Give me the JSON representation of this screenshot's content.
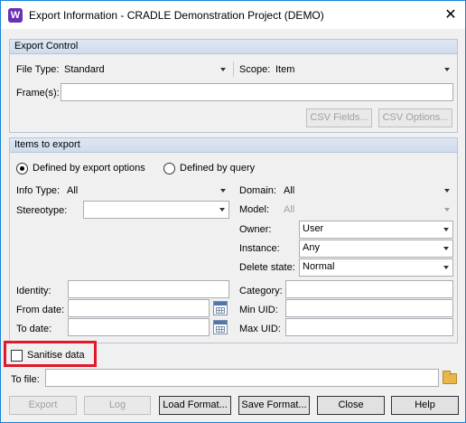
{
  "window": {
    "title": "Export Information - CRADLE Demonstration Project (DEMO)",
    "app_icon": "W",
    "close_glyph": "✕"
  },
  "export_control": {
    "header": "Export Control",
    "file_type_label": "File Type:",
    "file_type_value": "Standard",
    "scope_label": "Scope:",
    "scope_value": "Item",
    "frames_label": "Frame(s):",
    "frames_value": "",
    "csv_fields_button": "CSV Fields...",
    "csv_options_button": "CSV Options..."
  },
  "items_to_export": {
    "header": "Items to export",
    "radio_export_options": "Defined by export options",
    "radio_query": "Defined by query",
    "selected_radio": "export_options",
    "info_type_label": "Info Type:",
    "info_type_value": "All",
    "stereotype_label": "Stereotype:",
    "stereotype_value": "",
    "domain_label": "Domain:",
    "domain_value": "All",
    "model_label": "Model:",
    "model_value": "All",
    "owner_label": "Owner:",
    "owner_value": "User",
    "instance_label": "Instance:",
    "instance_value": "Any",
    "delete_state_label": "Delete state:",
    "delete_state_value": "Normal",
    "identity_label": "Identity:",
    "from_date_label": "From date:",
    "to_date_label": "To date:",
    "category_label": "Category:",
    "min_uid_label": "Min UID:",
    "max_uid_label": "Max UID:"
  },
  "sanitise_label": "Sanitise data",
  "sanitise_checked": false,
  "to_file_label": "To file:",
  "to_file_value": "",
  "buttons": {
    "export": "Export",
    "log": "Log",
    "load_format": "Load Format...",
    "save_format": "Save Format...",
    "close": "Close",
    "help": "Help"
  },
  "colors": {
    "highlight": "#e0192b",
    "group_header": "#dfe8f3",
    "app_icon": "#6b2fb5"
  }
}
